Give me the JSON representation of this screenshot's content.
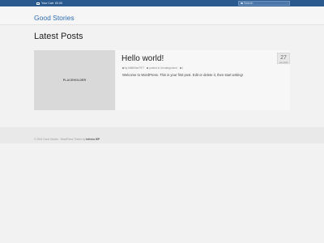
{
  "topbar": {
    "cart_label": "Your Cart",
    "cart_total": "£0.00"
  },
  "search": {
    "placeholder": "Search"
  },
  "site": {
    "title": "Good Stories"
  },
  "page": {
    "title": "Latest Posts"
  },
  "posts": [
    {
      "title": "Hello world!",
      "image_label": "PLACEHOLDER",
      "meta": {
        "author": "by fd86b9ae7977",
        "category": "posted in Uncategorized",
        "comments": "1"
      },
      "excerpt": "Welcome to WordPress. This is your first post. Edit or delete it, then start writing!",
      "date_day": "27",
      "date_month": "Jan 2020"
    }
  ],
  "footer": {
    "copyright": "© 2024 Good Stories · WordPress Theme by",
    "brand": "Inferno WP"
  },
  "colors": {
    "topbar": "#2b5a8f",
    "link": "#2b6cb0",
    "background": "#f2f2f2"
  }
}
